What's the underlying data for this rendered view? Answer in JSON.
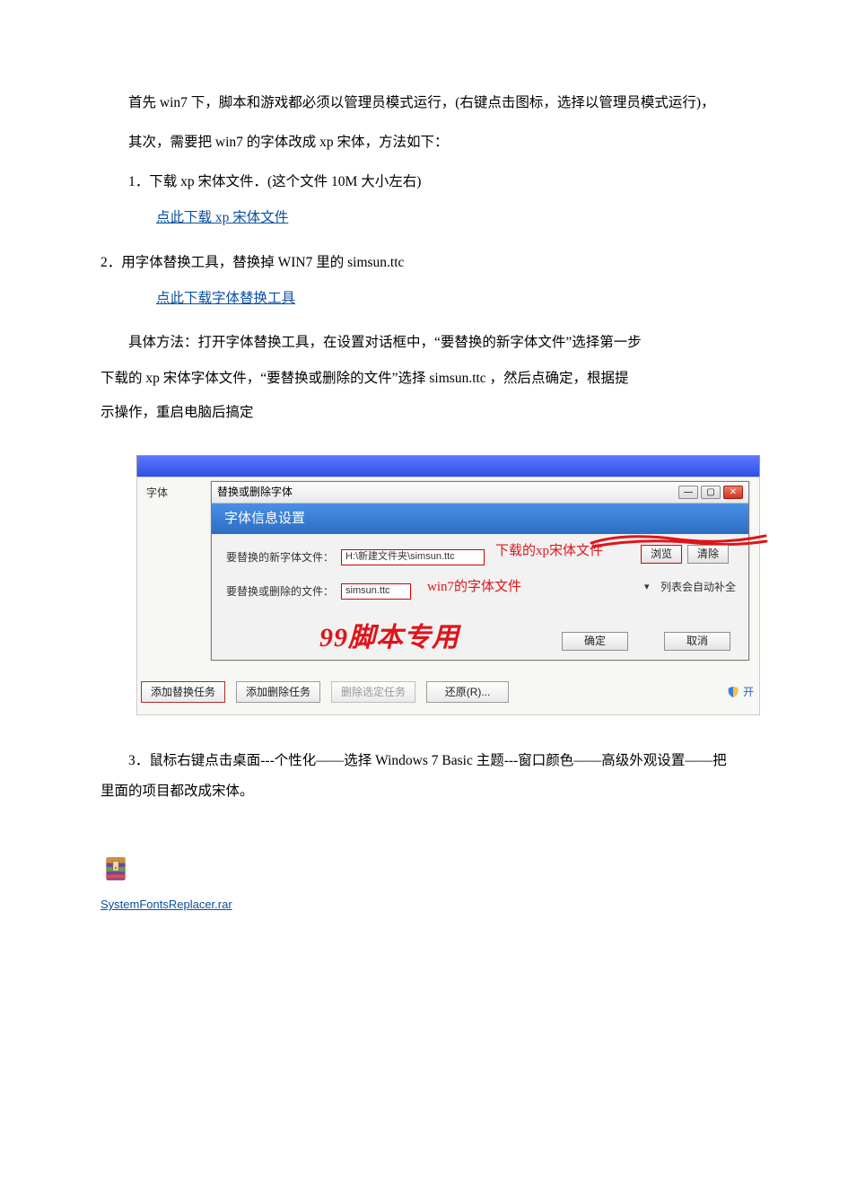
{
  "text": {
    "p1": "首先 win7 下，脚本和游戏都必须以管理员模式运行，(右键点击图标，选择以管理员模式运行)，",
    "p2": "其次，需要把 win7 的字体改成 xp 宋体，方法如下：",
    "list1_title": "1．下载 xp 宋体文件．(这个文件 10M 大小左右)",
    "link_download_font": "点此下载 xp 宋体文件",
    "list2_title": "2．用字体替换工具，替换掉 WIN7 里的 simsun.ttc",
    "link_download_tool": "点此下载字体替换工具",
    "inst_a": "具体方法：打开字体替换工具，在设置对话框中，“要替换的新字体文件”选择第一步",
    "inst_b": "下载的 xp 宋体字体文件，“要替换或删除的文件”选择 simsun.ttc ，然后点确定，根据提",
    "inst_c": "示操作，重启电脑后搞定",
    "list3": "3．鼠标右键点击桌面---个性化——选择 Windows 7 Basic 主题---窗口颜色——高级外观设置——把里面的项目都改成宋体。",
    "attachment_name": "SystemFontsReplacer.rar"
  },
  "shot": {
    "left_label": "字体",
    "dialog_title": "替换或删除字体",
    "dialog_header": "字体信息设置",
    "row1_label": "要替换的新字体文件：",
    "row1_input": "H:\\新建文件夹\\simsun.ttc",
    "row1_note": "下载的xp宋体文件",
    "browse": "浏览",
    "clear": "清除",
    "row2_label": "要替换或删除的文件：",
    "row2_input": "simsun.ttc",
    "row2_note": "win7的字体文件",
    "autofill": "列表会自动补全",
    "ok": "确定",
    "cancel": "取消",
    "watermark": "99脚本专用",
    "bottom_btn1": "添加替换任务",
    "bottom_btn2": "添加删除任务",
    "bottom_btn3": "删除选定任务",
    "bottom_btn4": "还原(R)...",
    "start": "开"
  }
}
